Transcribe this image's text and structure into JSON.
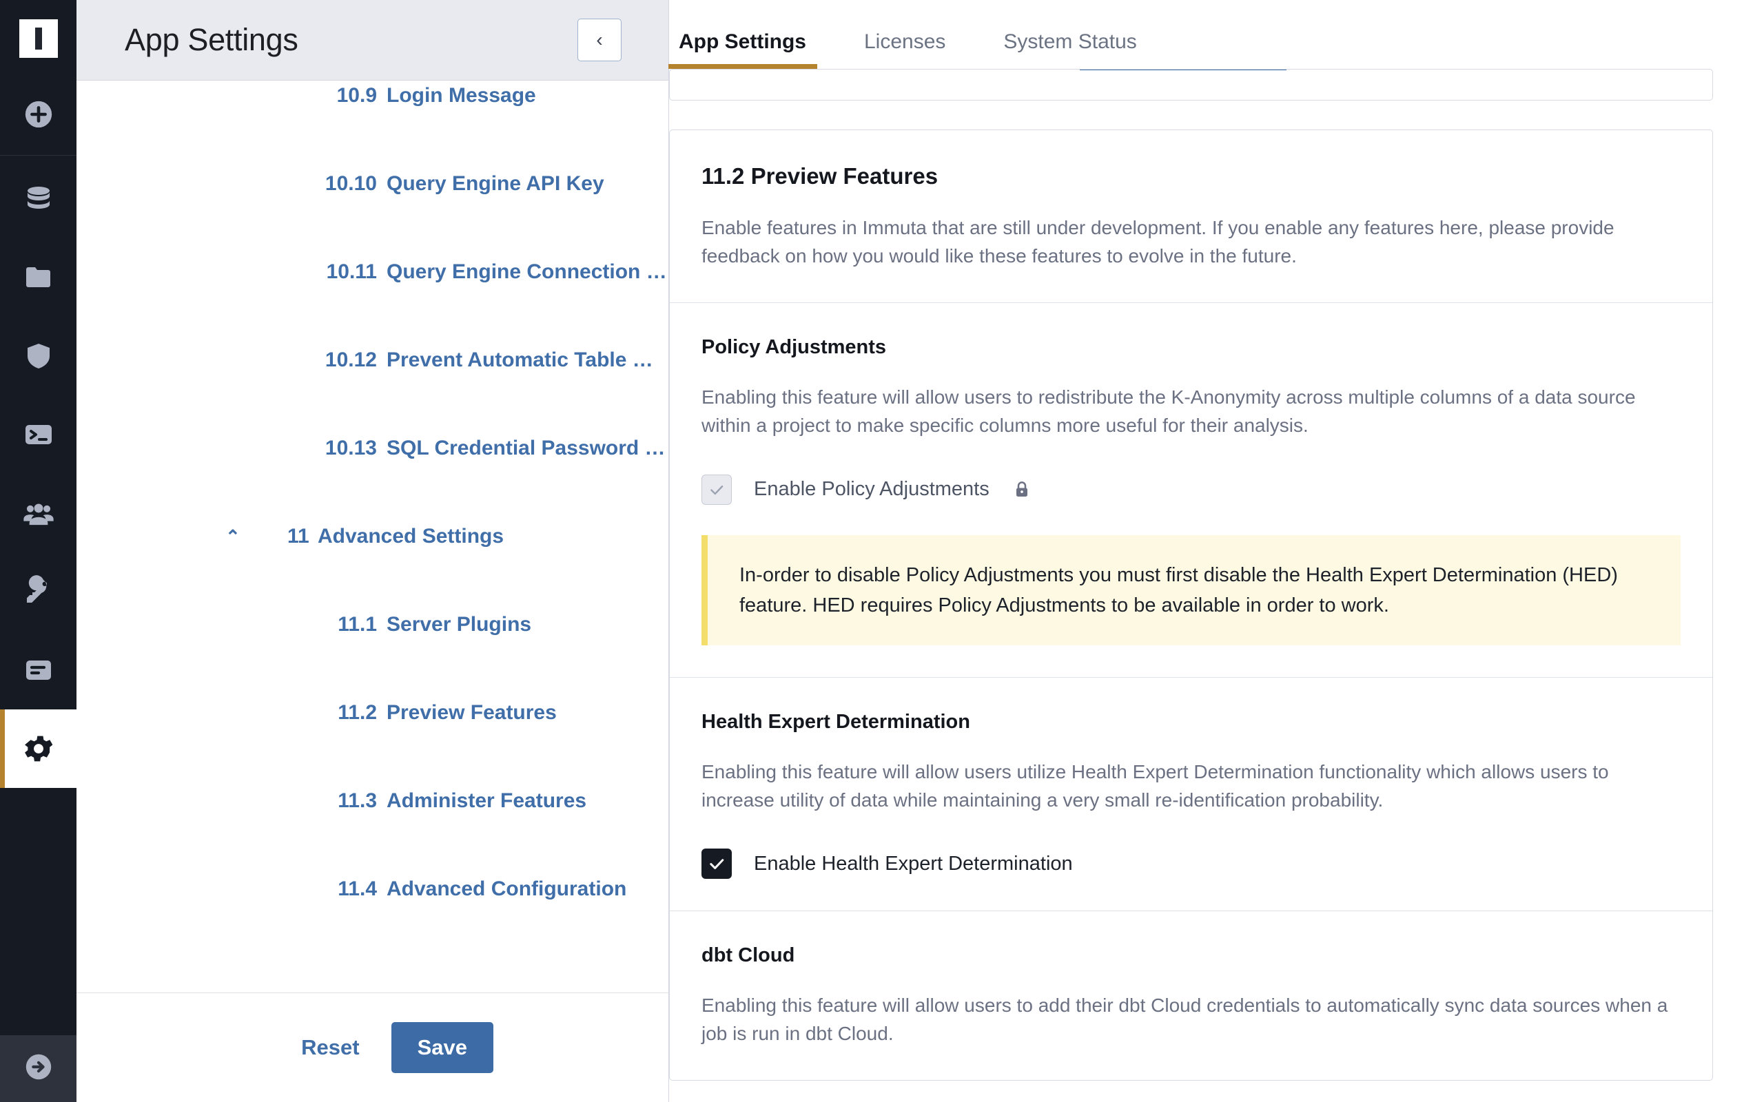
{
  "rail": {
    "logo_label": "immuta-logo",
    "items": [
      {
        "name": "create-icon",
        "label": "Create"
      },
      {
        "name": "database-icon",
        "label": "Data Sources"
      },
      {
        "name": "folder-icon",
        "label": "Projects"
      },
      {
        "name": "shield-icon",
        "label": "Policies"
      },
      {
        "name": "terminal-icon",
        "label": "Query Engine"
      },
      {
        "name": "people-icon",
        "label": "People"
      },
      {
        "name": "key-icon",
        "label": "Identity"
      },
      {
        "name": "report-icon",
        "label": "Reports"
      },
      {
        "name": "gear-icon",
        "label": "App Settings"
      }
    ],
    "active_index": 8,
    "footer_icon": "logout-icon",
    "accent_color": "#b5822e"
  },
  "nav_panel": {
    "title": "App Settings",
    "collapse_icon": "chevron-left-icon",
    "items": [
      {
        "num": "10.9",
        "label": "Login Message",
        "level": 2,
        "partial": true
      },
      {
        "num": "10.10",
        "label": "Query Engine API Key",
        "level": 2
      },
      {
        "num": "10.11",
        "label": "Query Engine Connection …",
        "level": 2
      },
      {
        "num": "10.12",
        "label": "Prevent Automatic Table …",
        "level": 2
      },
      {
        "num": "10.13",
        "label": "SQL Credential Password …",
        "level": 2
      },
      {
        "num": "11",
        "label": "Advanced Settings",
        "level": 1,
        "expanded": true,
        "caret": "chevron-up-icon"
      },
      {
        "num": "11.1",
        "label": "Server Plugins",
        "level": 2
      },
      {
        "num": "11.2",
        "label": "Preview Features",
        "level": 2
      },
      {
        "num": "11.3",
        "label": "Administer Features",
        "level": 2
      },
      {
        "num": "11.4",
        "label": "Advanced Configuration",
        "level": 2
      }
    ],
    "reset_label": "Reset",
    "save_label": "Save",
    "link_color": "#3f6ea8",
    "save_bg": "#3d6ba5"
  },
  "tabs": [
    {
      "label": "App Settings",
      "active": true
    },
    {
      "label": "Licenses",
      "active": false
    },
    {
      "label": "System Status",
      "active": false
    }
  ],
  "main": {
    "heading": "11.2 Preview Features",
    "intro": "Enable features in Immuta that are still under development. If you enable any features here, please provide feedback on how you would like these features to evolve in the future.",
    "sections": [
      {
        "title": "Policy Adjustments",
        "body": "Enabling this feature will allow users to redistribute the K-Anonymity across multiple columns of a data source within a project to make specific columns more useful for their analysis.",
        "checkbox": {
          "label": "Enable Policy Adjustments",
          "checked": true,
          "disabled": true,
          "lock_icon": "lock-icon"
        },
        "alert": "In-order to disable Policy Adjustments you must first disable the Health Expert Determination (HED) feature. HED requires Policy Adjustments to be available in order to work."
      },
      {
        "title": "Health Expert Determination",
        "body": "Enabling this feature will allow users utilize Health Expert Determination functionality which allows users to increase utility of data while maintaining a very small re-identification probability.",
        "checkbox": {
          "label": "Enable Health Expert Determination",
          "checked": true,
          "disabled": false
        }
      },
      {
        "title": "dbt Cloud",
        "body": "Enabling this feature will allow users to add their dbt Cloud credentials to automatically sync data sources when a job is run in dbt Cloud."
      }
    ],
    "alert_bg": "#fdf9e3",
    "alert_border": "#f3dd6b"
  }
}
